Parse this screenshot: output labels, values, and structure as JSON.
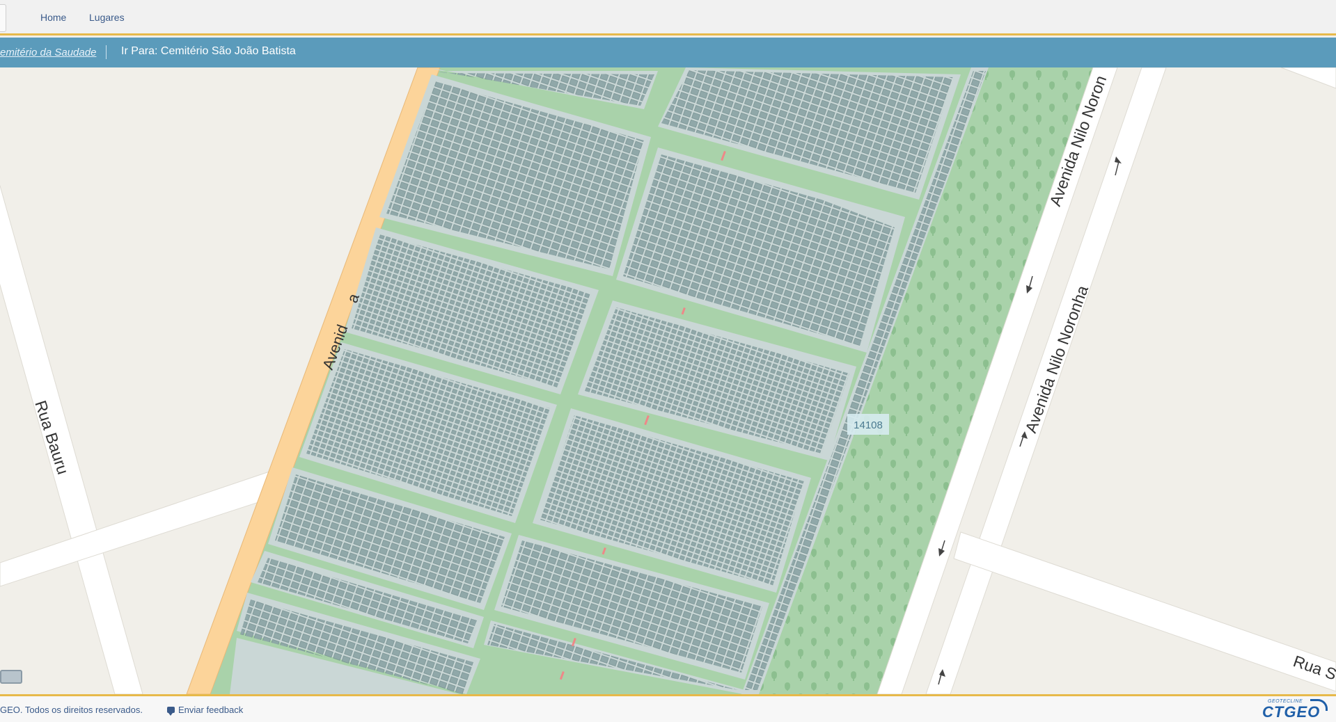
{
  "nav": {
    "home": "Home",
    "places": "Lugares"
  },
  "breadcrumb": {
    "current": "emitério da Saudade",
    "goto": "Ir Para: Cemitério São João Batista"
  },
  "map": {
    "streets": {
      "rua_bauru": "Rua Bauru",
      "avenida_upper": "Avenida Nilo Noron",
      "avenida_lower": "Avenida Nilo Noronha",
      "avenida_left_fragment": "Avenid",
      "avenida_left_fragment2": "a",
      "rua_bottom": "Rua S"
    },
    "parcel_label": "14108",
    "colors": {
      "cemetery": "#a9d2aa",
      "grass": "#a3cfa6",
      "block": "#cad7d6",
      "grave": "#8da6a7",
      "road": "#ffffff",
      "primary_road": "#fcd49a",
      "land": "#f1efe9"
    }
  },
  "footer": {
    "copyright": "GEO. Todos os direitos reservados.",
    "feedback": "Enviar feedback",
    "logo_small": "GEOTECLINE",
    "logo_big": "CTGEO"
  }
}
